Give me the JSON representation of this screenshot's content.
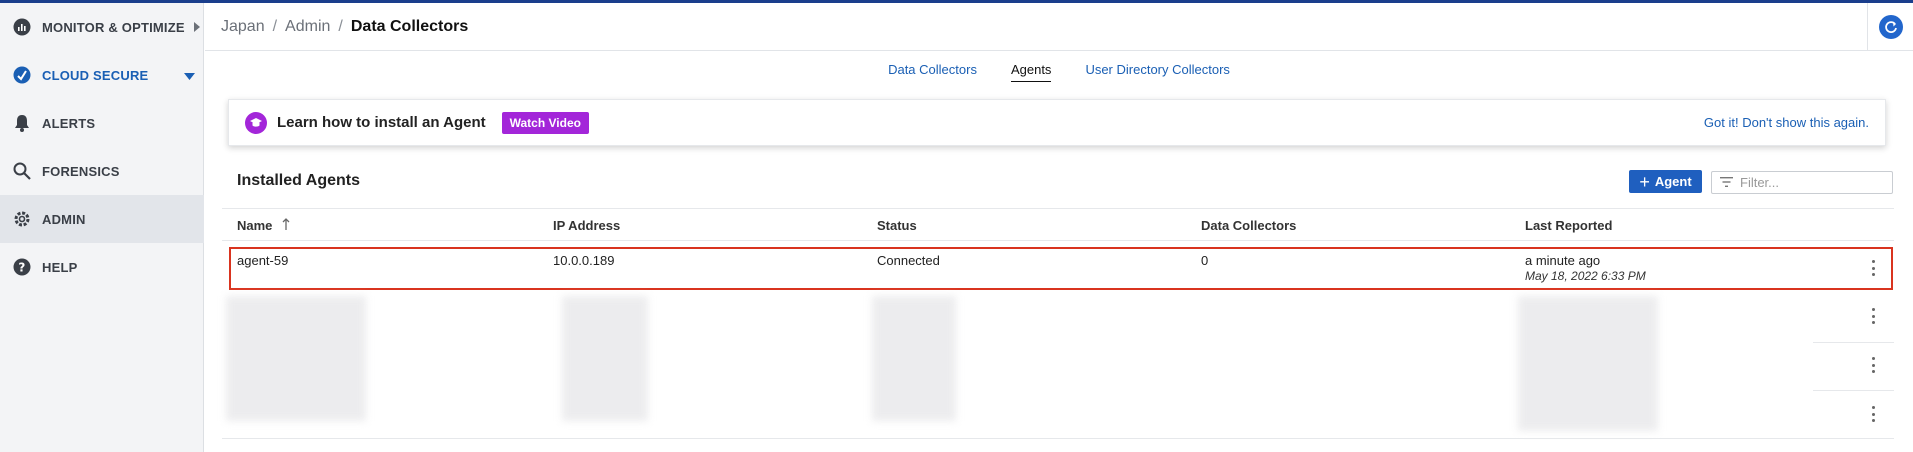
{
  "sidebar": {
    "items": [
      {
        "label": "MONITOR & OPTIMIZE",
        "icon": "chart-icon"
      },
      {
        "label": "CLOUD SECURE",
        "icon": "shield-icon"
      },
      {
        "label": "ALERTS",
        "icon": "bell-icon"
      },
      {
        "label": "FORENSICS",
        "icon": "search-icon"
      },
      {
        "label": "ADMIN",
        "icon": "gear-icon"
      },
      {
        "label": "HELP",
        "icon": "help-icon"
      }
    ]
  },
  "breadcrumb": {
    "items": [
      "Japan",
      "Admin"
    ],
    "separator": "/",
    "current": "Data Collectors"
  },
  "tabs": [
    {
      "label": "Data Collectors",
      "active": false
    },
    {
      "label": "Agents",
      "active": true
    },
    {
      "label": "User Directory Collectors",
      "active": false
    }
  ],
  "banner": {
    "text": "Learn how to install an Agent",
    "watch_label": "Watch Video",
    "dismiss_label": "Got it! Don't show this again."
  },
  "agents": {
    "title": "Installed Agents",
    "add_label": "Agent",
    "filter_placeholder": "Filter...",
    "columns": [
      "Name",
      "IP Address",
      "Status",
      "Data Collectors",
      "Last Reported"
    ],
    "rows": [
      {
        "name": "agent-59",
        "ip": "10.0.0.189",
        "status": "Connected",
        "collectors": "0",
        "last_reported": "a minute ago",
        "timestamp": "May 18, 2022 6:33 PM"
      }
    ]
  },
  "colors": {
    "accent": "#1f5fbf",
    "banner_purple": "#a326d9",
    "highlight": "#d9341f"
  }
}
